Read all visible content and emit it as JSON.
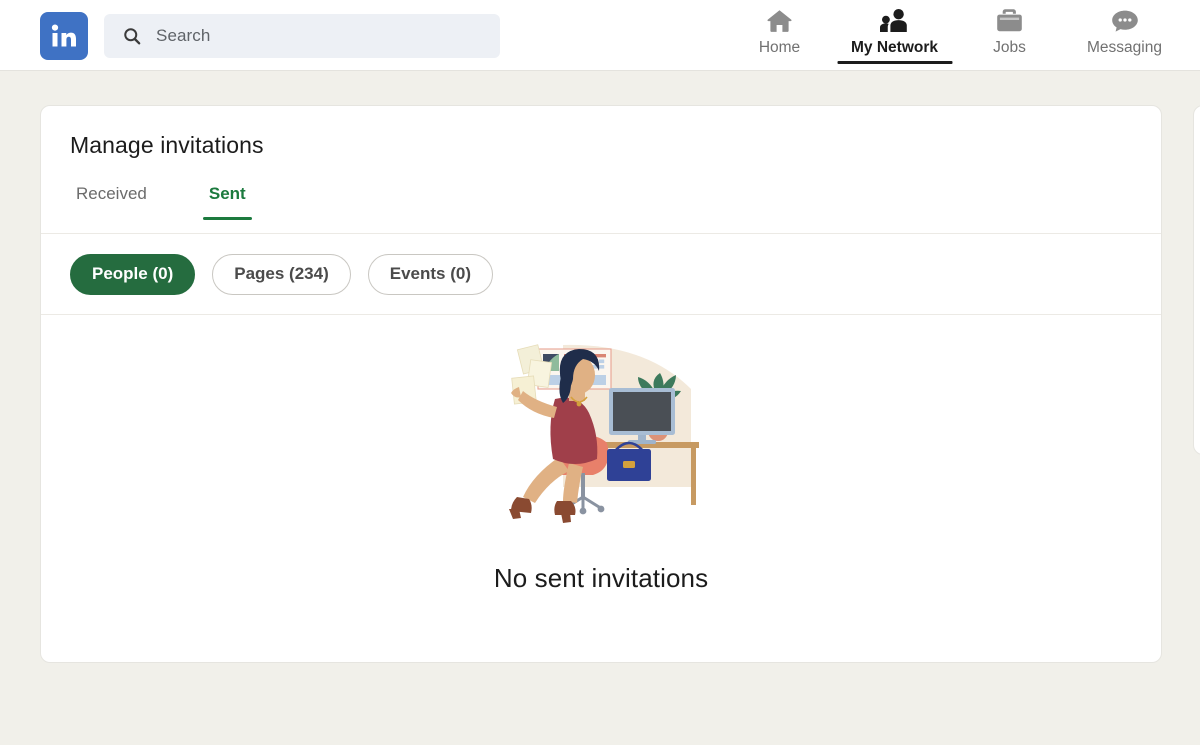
{
  "header": {
    "logo": {
      "icon": "linkedin-logo",
      "text": "in",
      "color": "#3f72c4"
    },
    "search": {
      "icon": "search-icon",
      "value": "",
      "placeholder": "Search"
    },
    "nav_items": [
      {
        "icon": "home-icon",
        "label": "Home",
        "active": false
      },
      {
        "icon": "my-network-icon",
        "label": "My Network",
        "active": true
      },
      {
        "icon": "jobs-icon",
        "label": "Jobs",
        "active": false
      },
      {
        "icon": "messaging-icon",
        "label": "Messaging",
        "active": false
      }
    ]
  },
  "card": {
    "title": "Manage invitations",
    "tabs": [
      {
        "label": "Received",
        "active": false
      },
      {
        "label": "Sent",
        "active": true
      }
    ],
    "filters": [
      {
        "label": "People (0)",
        "selected": true
      },
      {
        "label": "Pages (234)",
        "selected": false
      },
      {
        "label": "Events (0)",
        "selected": false
      }
    ],
    "empty_state": {
      "illustration": "woman-at-desk-illustration",
      "message": "No sent invitations"
    }
  },
  "colors": {
    "accent_green": "#256c3f",
    "tab_active_green": "#1c7a3e",
    "brand_blue": "#3f72c4",
    "page_background": "#f1f0ea",
    "card_background": "#ffffff"
  }
}
